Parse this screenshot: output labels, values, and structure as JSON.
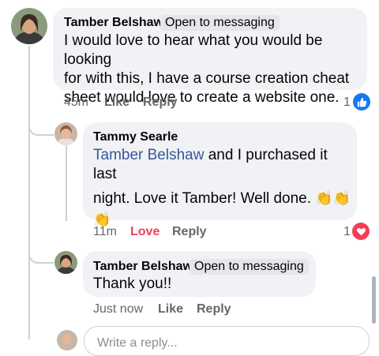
{
  "comments": [
    {
      "author": "Tamber Belshaw",
      "badge": "Open to messaging",
      "text_lines": [
        "I would love to hear what you would be looking",
        "for with this, I have a course creation cheat",
        "sheet would love to create a website one."
      ],
      "time": "45m",
      "like": "Like",
      "reply": "Reply",
      "reaction_count": "1",
      "reaction": "like-icon"
    },
    {
      "author": "Tammy Searle",
      "mention": "Tamber Belshaw",
      "text_after_mention": " and I purchased it last",
      "text_line2": "night.  Love it Tamber!  Well done.",
      "clap": "👏👏",
      "clap2": "👏",
      "time": "11m",
      "like": "Love",
      "reply": "Reply",
      "reaction_count": "1",
      "reaction": "love-icon"
    },
    {
      "author": "Tamber Belshaw",
      "badge": "Open to messaging",
      "text": "Thank you!!",
      "time": "Just now",
      "like": "Like",
      "reply": "Reply"
    }
  ],
  "composer": {
    "placeholder": "Write a reply..."
  },
  "colors": {
    "bubble": "#f0f2f5",
    "mention": "#385898",
    "love": "#f33e58",
    "like": "#1877f2"
  }
}
